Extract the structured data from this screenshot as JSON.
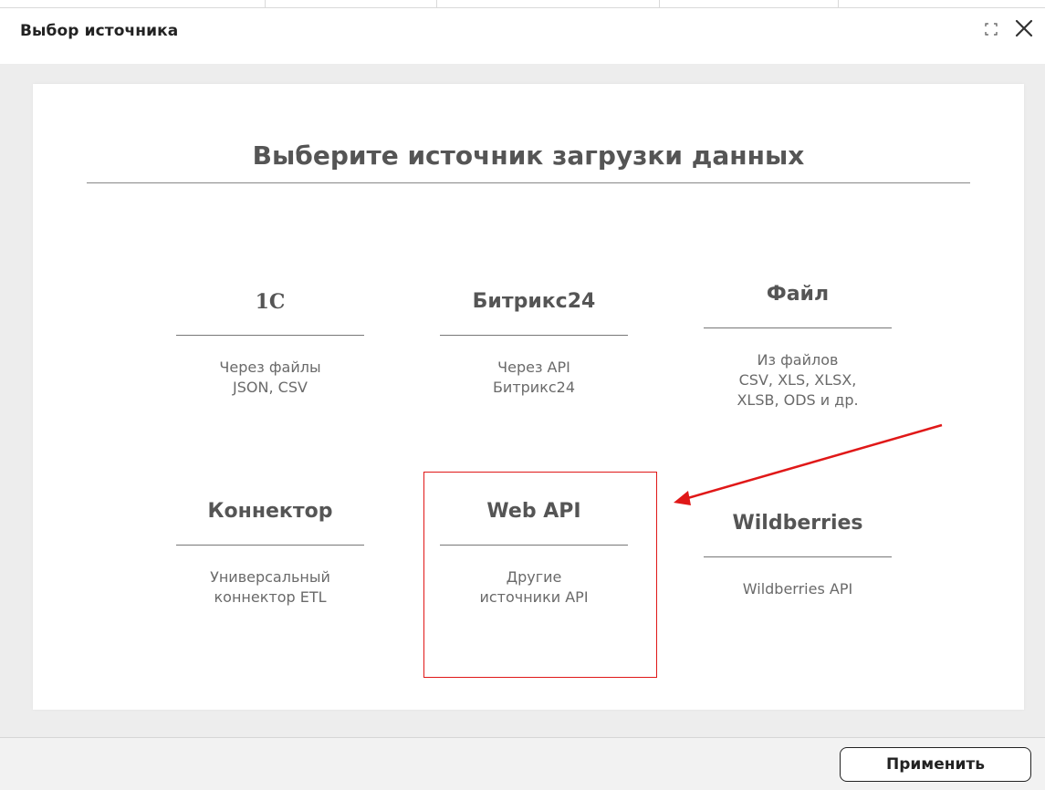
{
  "dialog": {
    "title": "Выбор источника",
    "controls": {
      "expand_icon": "expand-icon",
      "close_icon": "close-icon"
    }
  },
  "card": {
    "heading": "Выберите источник загрузки данных",
    "options": [
      {
        "title": "1C",
        "description": "Через файлы\nJSON, CSV"
      },
      {
        "title": "Битрикс24",
        "description": "Через API\nБитрикс24"
      },
      {
        "title": "Файл",
        "description": "Из файлов\nCSV, XLS, XLSX,\nXLSB, ODS и др."
      },
      {
        "title": "Коннектор",
        "description": "Универсальный\nконнектор ETL"
      },
      {
        "title": "Web API",
        "description": "Другие\nисточники API"
      },
      {
        "title": "Wildberries",
        "description": "Wildberries API"
      }
    ]
  },
  "annotation": {
    "highlight_color": "#e01818",
    "arrow_color": "#e01818"
  },
  "footer": {
    "apply_label": "Применить"
  }
}
